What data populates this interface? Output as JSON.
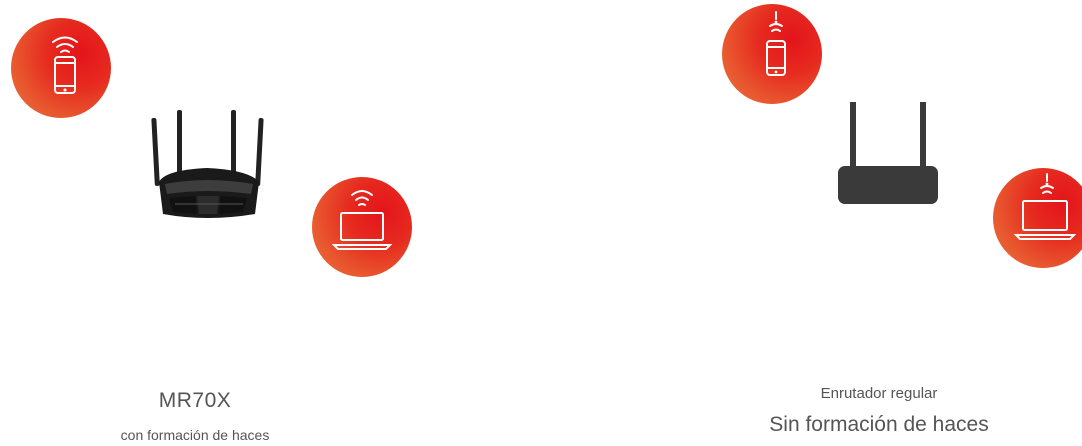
{
  "left": {
    "title": "MR70X",
    "subtitle": "con formación de haces"
  },
  "right": {
    "subtitle": "Enrutador regular",
    "title": "Sin formación de haces"
  },
  "colors": {
    "accent_red": "#e4141b",
    "accent_orange": "#eb7440",
    "router_dark": "#3a3a3a"
  },
  "icons": [
    "phone-icon",
    "laptop-icon",
    "wifi-signal-icon",
    "warning-exclamation-icon",
    "router-icon"
  ]
}
